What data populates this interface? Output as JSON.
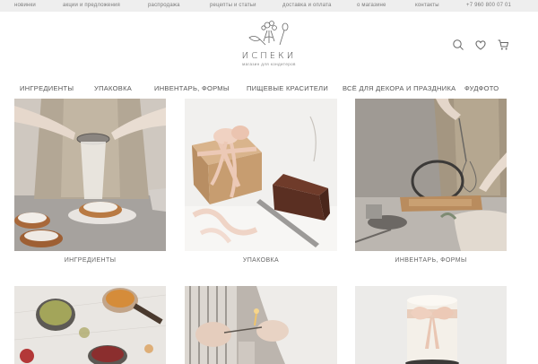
{
  "topbar": {
    "items": [
      "новинки",
      "акции и предложения",
      "распродажа",
      "рецепты и статьи",
      "доставка и оплата",
      "о магазине",
      "контакты"
    ],
    "phone": "+7 960 800 07 01"
  },
  "logo": {
    "name": "ИСПЕКИ",
    "tagline": "магазин для кондитеров"
  },
  "header_icons": [
    "search-icon",
    "heart-icon",
    "cart-icon"
  ],
  "nav": {
    "items": [
      "ИНГРЕДИЕНТЫ",
      "УПАКОВКА",
      "ИНВЕНТАРЬ, ФОРМЫ",
      "ПИЩЕВЫЕ КРАСИТЕЛИ",
      "ВСЁ ДЛЯ ДЕКОРА И ПРАЗДНИКА",
      "ФУДФОТО"
    ]
  },
  "categories": [
    {
      "caption": "ИНГРЕДИЕНТЫ"
    },
    {
      "caption": "УПАКОВКА"
    },
    {
      "caption": "ИНВЕНТАРЬ, ФОРМЫ"
    }
  ],
  "colors": {
    "topbar_bg": "#eeeeee",
    "text": "#555555",
    "linen": "#b8ab9a",
    "kraft": "#c8a27a",
    "ribbon": "#e8c7b4"
  }
}
